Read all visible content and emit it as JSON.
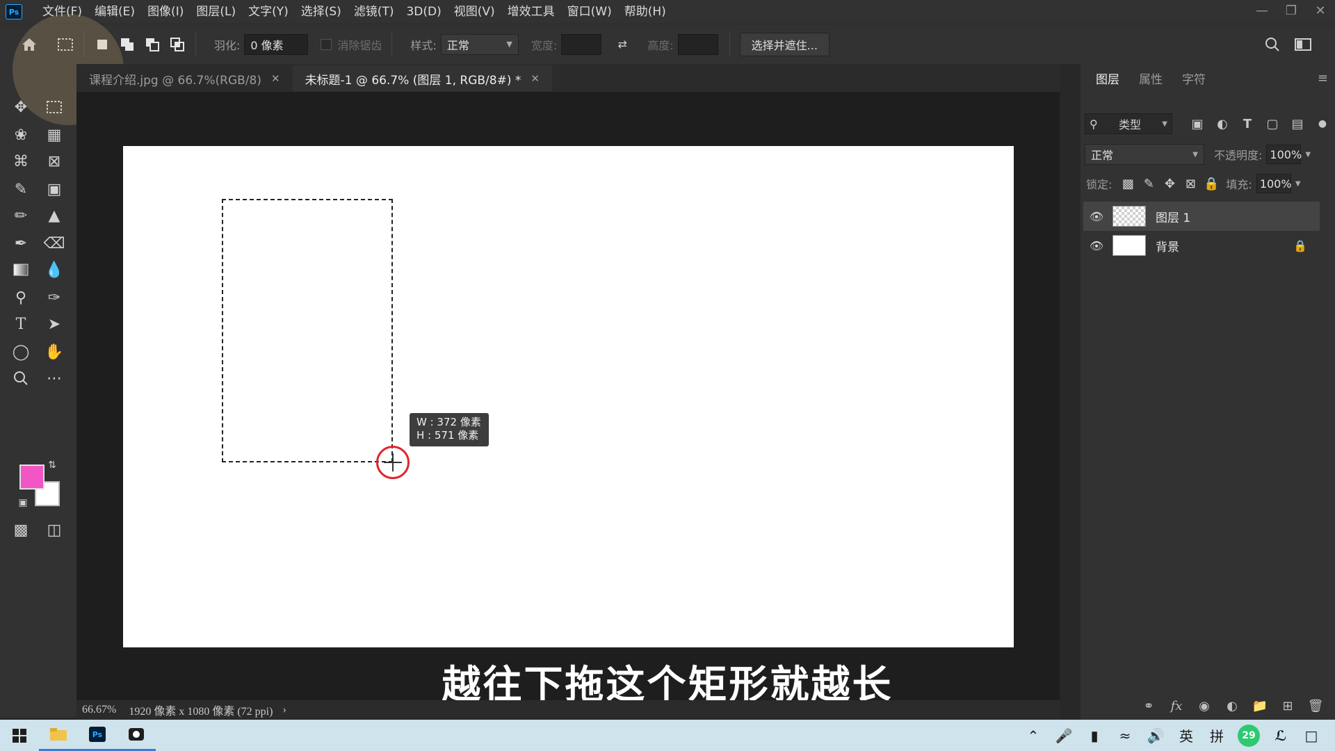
{
  "app": {
    "logo": "Ps"
  },
  "menu": [
    "文件(F)",
    "编辑(E)",
    "图像(I)",
    "图层(L)",
    "文字(Y)",
    "选择(S)",
    "滤镜(T)",
    "3D(D)",
    "视图(V)",
    "增效工具",
    "窗口(W)",
    "帮助(H)"
  ],
  "options": {
    "feather_label": "羽化:",
    "feather_value": "0 像素",
    "antialias_label": "消除锯齿",
    "style_label": "样式:",
    "style_value": "正常",
    "width_label": "宽度:",
    "height_label": "高度:",
    "select_mask_label": "选择并遮住..."
  },
  "tabs": [
    {
      "label": "课程介绍.jpg @ 66.7%(RGB/8)",
      "active": false
    },
    {
      "label": "未标题-1 @ 66.7% (图层 1, RGB/8#) *",
      "active": true
    }
  ],
  "canvas": {
    "size_tip_w": "W : 372 像素",
    "size_tip_h": "H : 571 像素"
  },
  "subtitle": "越往下拖这个矩形就越长",
  "status": {
    "zoom": "66.67%",
    "doc_info": "1920 像素 x 1080 像素 (72 ppi)",
    "arrow": "›"
  },
  "colors": {
    "foreground": "#f156c4",
    "background": "#ffffff",
    "selection_cursor": "#e0262e"
  },
  "panel": {
    "tabs": [
      "图层",
      "属性",
      "字符"
    ],
    "filter_label": "类型",
    "blend_mode": "正常",
    "opacity_label": "不透明度:",
    "opacity_value": "100%",
    "lock_label": "锁定:",
    "fill_label": "填充:",
    "fill_value": "100%",
    "layers": [
      {
        "name": "图层 1",
        "selected": true,
        "thumb": "checker"
      },
      {
        "name": "背景",
        "selected": false,
        "thumb": "white",
        "locked": true
      }
    ]
  },
  "taskbar": {
    "ime_lang": "英",
    "ime_mode": "拼",
    "badge": "29"
  }
}
